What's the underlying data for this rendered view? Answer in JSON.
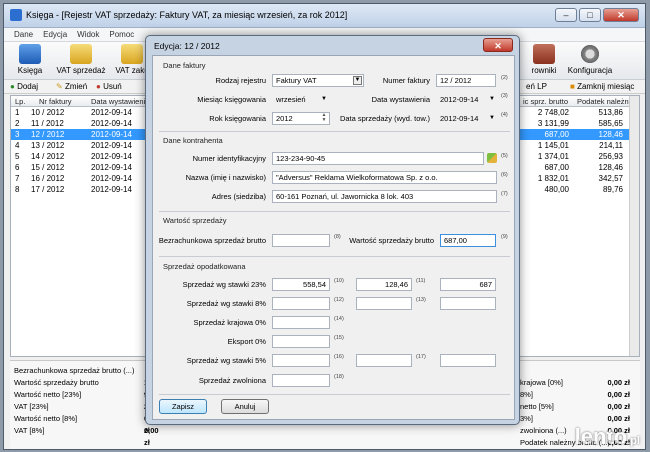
{
  "window": {
    "title": "Księga - [Rejestr VAT sprzedaży: Faktury VAT, za miesiąc wrzesień, za rok 2012]",
    "controls": {
      "minimize": "–",
      "maximize": "□",
      "close": "✕"
    }
  },
  "menu": [
    "Dane",
    "Edycja",
    "Widok",
    "Pomoc"
  ],
  "toolbar": {
    "items": [
      {
        "label": "Księga",
        "icon": "book-icon"
      },
      {
        "label": "VAT sprzedaż",
        "icon": "vat-sales-icon"
      },
      {
        "label": "VAT zaku",
        "icon": "vat-purchase-icon"
      },
      {
        "label": "rowniki",
        "icon": "employees-icon"
      },
      {
        "label": "Konfiguracja",
        "icon": "gear-icon"
      }
    ]
  },
  "actions": {
    "add": "Dodaj",
    "edit": "Zmień",
    "delete": "Usuń",
    "list_lp": "eń LP",
    "close_month": "Zamknij miesiąc"
  },
  "grid": {
    "headers": {
      "lp": "Lp.",
      "nr": "Nr faktury",
      "date": "Data wystawienia",
      "brutto": "ic sprz. brutto",
      "vat": "Podatek należny"
    },
    "rows": [
      {
        "lp": "1",
        "nr": "10 / 2012",
        "date": "2012-09-14",
        "brutto": "2 748,02",
        "vat": "513,86"
      },
      {
        "lp": "2",
        "nr": "11 / 2012",
        "date": "2012-09-14",
        "brutto": "3 131,99",
        "vat": "585,65"
      },
      {
        "lp": "3",
        "nr": "12 / 2012",
        "date": "2012-09-14",
        "brutto": "687,00",
        "vat": "128,46"
      },
      {
        "lp": "4",
        "nr": "13 / 2012",
        "date": "2012-09-14",
        "brutto": "1 145,01",
        "vat": "214,11"
      },
      {
        "lp": "5",
        "nr": "14 / 2012",
        "date": "2012-09-14",
        "brutto": "1 374,01",
        "vat": "256,93"
      },
      {
        "lp": "6",
        "nr": "15 / 2012",
        "date": "2012-09-14",
        "brutto": "687,00",
        "vat": "128,46"
      },
      {
        "lp": "7",
        "nr": "16 / 2012",
        "date": "2012-09-14",
        "brutto": "1 832,01",
        "vat": "342,57"
      },
      {
        "lp": "8",
        "nr": "17 / 2012",
        "date": "2012-09-14",
        "brutto": "480,00",
        "vat": "89,76"
      }
    ]
  },
  "summary": {
    "left": [
      {
        "label": "Bezrachunkowa sprzedaż brutto (...)",
        "value": ""
      },
      {
        "label": "Wartość sprzedaży brutto",
        "value": "12"
      },
      {
        "label": "Wartość netto [23%]",
        "value": "9"
      },
      {
        "label": "VAT [23%]",
        "value": "2"
      },
      {
        "label": "Wartość netto [8%]",
        "value": "0,00 zł"
      },
      {
        "label": "VAT [8%]",
        "value": "0,00 zł"
      }
    ],
    "right": [
      {
        "label": "",
        "value": ""
      },
      {
        "label": "krajowa [0%]",
        "value": "0,00 zł"
      },
      {
        "label": "8%]",
        "value": "0,00 zł"
      },
      {
        "label": "netto [5%]",
        "value": "0,00 zł"
      },
      {
        "label": "3%]",
        "value": "0,00 zł"
      },
      {
        "label": "zwolniona (...)",
        "value": "0,00 zł"
      },
      {
        "label": "Podatek należny brutto (...)",
        "value": "0,00 zł"
      }
    ]
  },
  "dialog": {
    "title": "Edycja: 12 / 2012",
    "close": "✕",
    "invoice": {
      "group": "Dane faktury",
      "register_label": "Rodzaj rejestru",
      "register_value": "Faktury VAT",
      "number_label": "Numer faktury",
      "number_value": "12 / 2012",
      "number_sup": "(2)",
      "month_label": "Miesiąc księgowania",
      "month_value": "wrzesień",
      "issue_label": "Data wystawienia",
      "issue_value": "2012-09-14",
      "issue_sup": "(3)",
      "year_label": "Rok księgowania",
      "year_value": "2012",
      "sale_label": "Data sprzedaży (wyd. tow.)",
      "sale_value": "2012-09-14",
      "sale_sup": "(4)"
    },
    "contractor": {
      "group": "Dane kontrahenta",
      "nip_label": "Numer identyfikacyjny",
      "nip_value": "123-234-90-45",
      "nip_sup": "(5)",
      "name_label": "Nazwa (imię i nazwisko)",
      "name_value": "\"Adversus\" Reklama Wielkoformatowa Sp. z o.o.",
      "name_sup": "(6)",
      "addr_label": "Adres (siedziba)",
      "addr_value": "60-161  Poznań, ul. Jawornicka 8 lok. 403",
      "addr_sup": "(7)"
    },
    "sale_value": {
      "group": "Wartość sprzedaży",
      "noncash_label": "Bezrachunkowa sprzedaż brutto",
      "noncash_value": "",
      "noncash_sup": "(8)",
      "gross_label": "Wartość sprzedaży brutto",
      "gross_value": "687,00",
      "gross_sup": "(9)"
    },
    "taxed": {
      "group": "Sprzedaż opodatkowana",
      "rows": [
        {
          "label": "Sprzedaż wg stawki 23%",
          "a": "558,54",
          "sa": "(10)",
          "b": "128,46",
          "sb": "(11)",
          "c": "687"
        },
        {
          "label": "Sprzedaż wg stawki 8%",
          "a": "",
          "sa": "(12)",
          "b": "",
          "sb": "(13)",
          "c": ""
        },
        {
          "label": "Sprzedaż krajowa 0%",
          "a": "",
          "sa": "(14)"
        },
        {
          "label": "Eksport 0%",
          "a": "",
          "sa": "(15)"
        },
        {
          "label": "Sprzedaż wg stawki 5%",
          "a": "",
          "sa": "(16)",
          "b": "",
          "sb": "(17)",
          "c": ""
        },
        {
          "label": "Sprzedaż zwolniona",
          "a": "",
          "sa": "(18)"
        }
      ]
    },
    "save": "Zapisz",
    "cancel": "Anuluj"
  },
  "watermark": {
    "text": "lento",
    "suffix": ".pl"
  },
  "colors": {
    "selection": "#3399ff",
    "dialog_frame": "#c5d3e3",
    "close_red": "#c0392b"
  }
}
